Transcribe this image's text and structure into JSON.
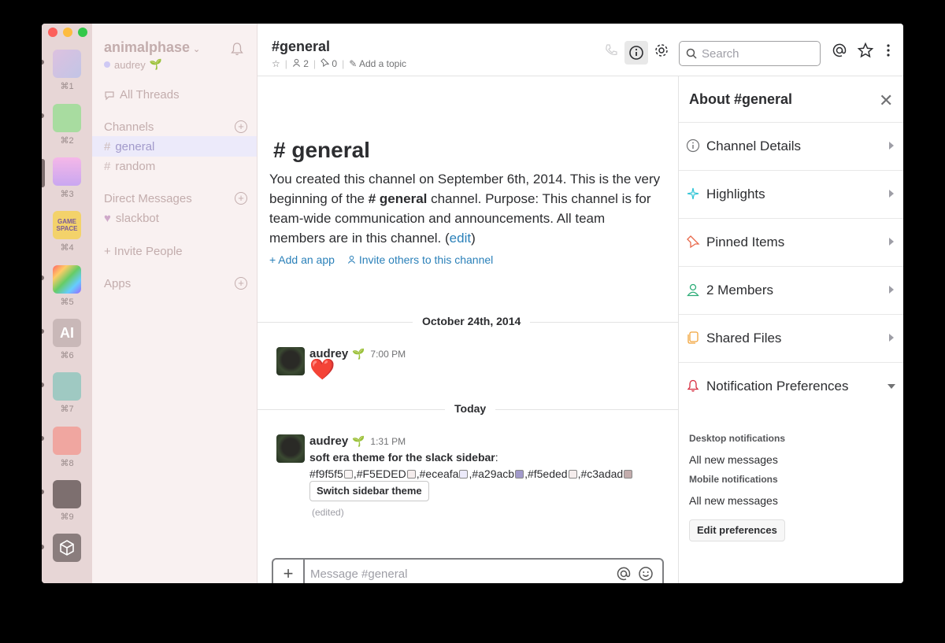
{
  "team_rail": {
    "shortcuts": [
      "⌘1",
      "⌘2",
      "⌘3",
      "⌘4",
      "⌘5",
      "⌘6",
      "⌘7",
      "⌘8",
      "⌘9"
    ],
    "ai_label": "AI",
    "team4_text": "GAME SPACE"
  },
  "sidebar": {
    "team_name": "animalphase",
    "user_name": "audrey",
    "user_emoji": "🌱",
    "all_threads": "All Threads",
    "channels_header": "Channels",
    "channels": [
      "general",
      "random"
    ],
    "dm_header": "Direct Messages",
    "dms": [
      "slackbot"
    ],
    "invite": "+ Invite People",
    "apps_header": "Apps"
  },
  "header": {
    "channel": "#general",
    "members_count": "2",
    "pins_count": "0",
    "add_topic": "Add a topic",
    "search_placeholder": "Search"
  },
  "intro": {
    "title": "# general",
    "line_start": "You created this channel on September 6th, 2014. This is the very beginning of the ",
    "channel_bold": "# general",
    "line_end": " channel. Purpose: This channel is for team-wide communication and announcements. All team members are in this channel. (",
    "edit_link": "edit",
    "close_paren": ")",
    "add_app": "Add an app",
    "invite_others": "Invite others to this channel"
  },
  "messages": {
    "divider1": "October 24th, 2014",
    "divider2": "Today",
    "m1_author": "audrey",
    "m1_time": "7:00 PM",
    "m1_heart": "❤️",
    "m2_author": "audrey",
    "m2_time": "1:31 PM",
    "m2_bold": "soft era theme for the slack sidebar",
    "m2_colon": ":",
    "colors": [
      "#f9f5f5",
      "#F5EDED",
      "#eceafa",
      "#a29acb",
      "#f5eded",
      "#c3adad",
      "#cfc9f4",
      "#cb8dd7"
    ],
    "switch_btn": "Switch sidebar theme",
    "edited": "(edited)",
    "composer_placeholder": "Message #general"
  },
  "panel": {
    "title": "About #general",
    "rows": [
      "Channel Details",
      "Highlights",
      "Pinned Items",
      "2 Members",
      "Shared Files",
      "Notification Preferences"
    ],
    "desktop_h": "Desktop notifications",
    "desktop_v": "All new messages",
    "mobile_h": "Mobile notifications",
    "mobile_v": "All new messages",
    "edit_prefs": "Edit preferences"
  },
  "colors": {
    "sidebar_bg": "#f9f1f1",
    "active": "#eceafa",
    "text_muted": "#c3adad",
    "link": "#2a80b9"
  }
}
